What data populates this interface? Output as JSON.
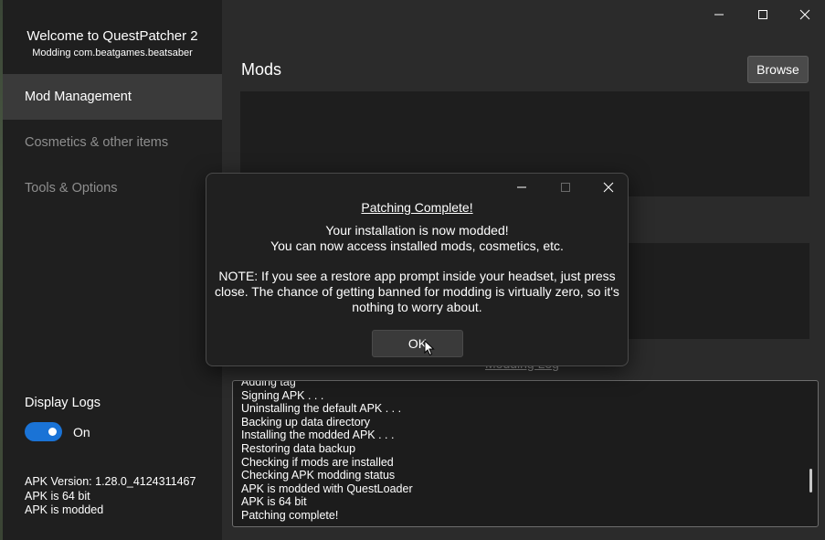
{
  "sidebar": {
    "title": "Welcome to QuestPatcher 2",
    "subtitle": "Modding com.beatgames.beatsaber",
    "nav": [
      {
        "label": "Mod Management",
        "active": true
      },
      {
        "label": "Cosmetics & other items",
        "active": false
      },
      {
        "label": "Tools & Options",
        "active": false
      }
    ],
    "display_logs_label": "Display Logs",
    "toggle_state": "On",
    "apk_info": [
      "APK Version: 1.28.0_4124311467",
      "APK is 64 bit",
      "APK is modded"
    ]
  },
  "main": {
    "title": "Mods",
    "browse_label": "Browse",
    "modding_log_label": "Modding Log"
  },
  "log": [
    "Adding tag",
    "Signing APK . . .",
    "Uninstalling the default APK . . .",
    "Backing up data directory",
    "Installing the modded APK . . .",
    "Restoring data backup",
    "Checking if mods are installed",
    "Checking APK modding status",
    "APK is modded with QuestLoader",
    "APK is 64 bit",
    "Patching complete!"
  ],
  "dialog": {
    "title": "Patching Complete!",
    "line1": "Your installation is now modded!",
    "line2": "You can now access installed mods, cosmetics, etc.",
    "note": "NOTE: If you see a restore app prompt inside your headset, just press close. The chance of getting banned for modding is virtually zero, so it's nothing to worry about.",
    "ok_label": "OK"
  },
  "colors": {
    "accent": "#1a73d6",
    "sidebar_bg": "#1f1f1f",
    "main_bg": "#2b2b2b"
  }
}
